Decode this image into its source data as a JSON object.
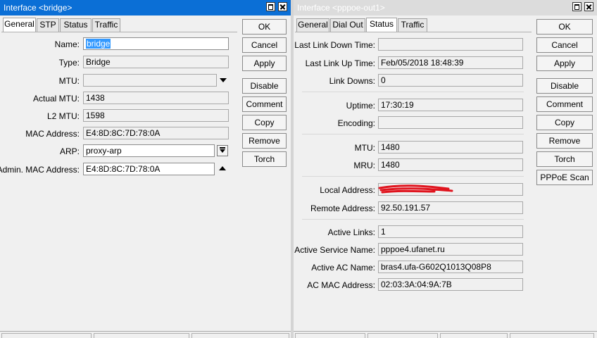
{
  "left_window": {
    "title": "Interface <bridge>",
    "tabs": [
      "General",
      "STP",
      "Status",
      "Traffic"
    ],
    "active_tab": "General",
    "fields": {
      "name": {
        "label": "Name:",
        "value": "bridge"
      },
      "type": {
        "label": "Type:",
        "value": "Bridge"
      },
      "mtu": {
        "label": "MTU:",
        "value": ""
      },
      "actual_mtu": {
        "label": "Actual MTU:",
        "value": "1438"
      },
      "l2_mtu": {
        "label": "L2 MTU:",
        "value": "1598"
      },
      "mac_address": {
        "label": "MAC Address:",
        "value": "E4:8D:8C:7D:78:0A"
      },
      "arp": {
        "label": "ARP:",
        "value": "proxy-arp"
      },
      "admin_mac": {
        "label": "Admin. MAC Address:",
        "value": "E4:8D:8C:7D:78:0A"
      }
    },
    "buttons": {
      "ok": "OK",
      "cancel": "Cancel",
      "apply": "Apply",
      "disable": "Disable",
      "comment": "Comment",
      "copy": "Copy",
      "remove": "Remove",
      "torch": "Torch"
    },
    "icons": [
      "maximize-icon",
      "close-icon",
      "dropdown-arrow-icon",
      "dropdown-button-icon",
      "collapse-arrow-icon"
    ]
  },
  "right_window": {
    "title": "Interface <pppoe-out1>",
    "tabs": [
      "General",
      "Dial Out",
      "Status",
      "Traffic"
    ],
    "active_tab": "Status",
    "fields": {
      "last_link_down": {
        "label": "Last Link Down Time:",
        "value": ""
      },
      "last_link_up": {
        "label": "Last Link Up Time:",
        "value": "Feb/05/2018 18:48:39"
      },
      "link_downs": {
        "label": "Link Downs:",
        "value": "0"
      },
      "uptime": {
        "label": "Uptime:",
        "value": "17:30:19"
      },
      "encoding": {
        "label": "Encoding:",
        "value": ""
      },
      "mtu": {
        "label": "MTU:",
        "value": "1480"
      },
      "mru": {
        "label": "MRU:",
        "value": "1480"
      },
      "local_address": {
        "label": "Local Address:",
        "value": ""
      },
      "remote_address": {
        "label": "Remote Address:",
        "value": "92.50.191.57"
      },
      "active_links": {
        "label": "Active Links:",
        "value": "1"
      },
      "active_service_name": {
        "label": "Active Service Name:",
        "value": "pppoe4.ufanet.ru"
      },
      "active_ac_name": {
        "label": "Active AC Name:",
        "value": "bras4.ufa-G602Q1013Q08P8"
      },
      "ac_mac_address": {
        "label": "AC MAC Address:",
        "value": "02:03:3A:04:9A:7B"
      }
    },
    "buttons": {
      "ok": "OK",
      "cancel": "Cancel",
      "apply": "Apply",
      "disable": "Disable",
      "comment": "Comment",
      "copy": "Copy",
      "remove": "Remove",
      "torch": "Torch",
      "pppoe_scan": "PPPoE Scan"
    },
    "colors": {
      "redaction": "#e0141e"
    }
  },
  "colors": {
    "active_title": "#0b6fd6",
    "inactive_title": "#dcdcdc",
    "selection": "#3399ff"
  }
}
